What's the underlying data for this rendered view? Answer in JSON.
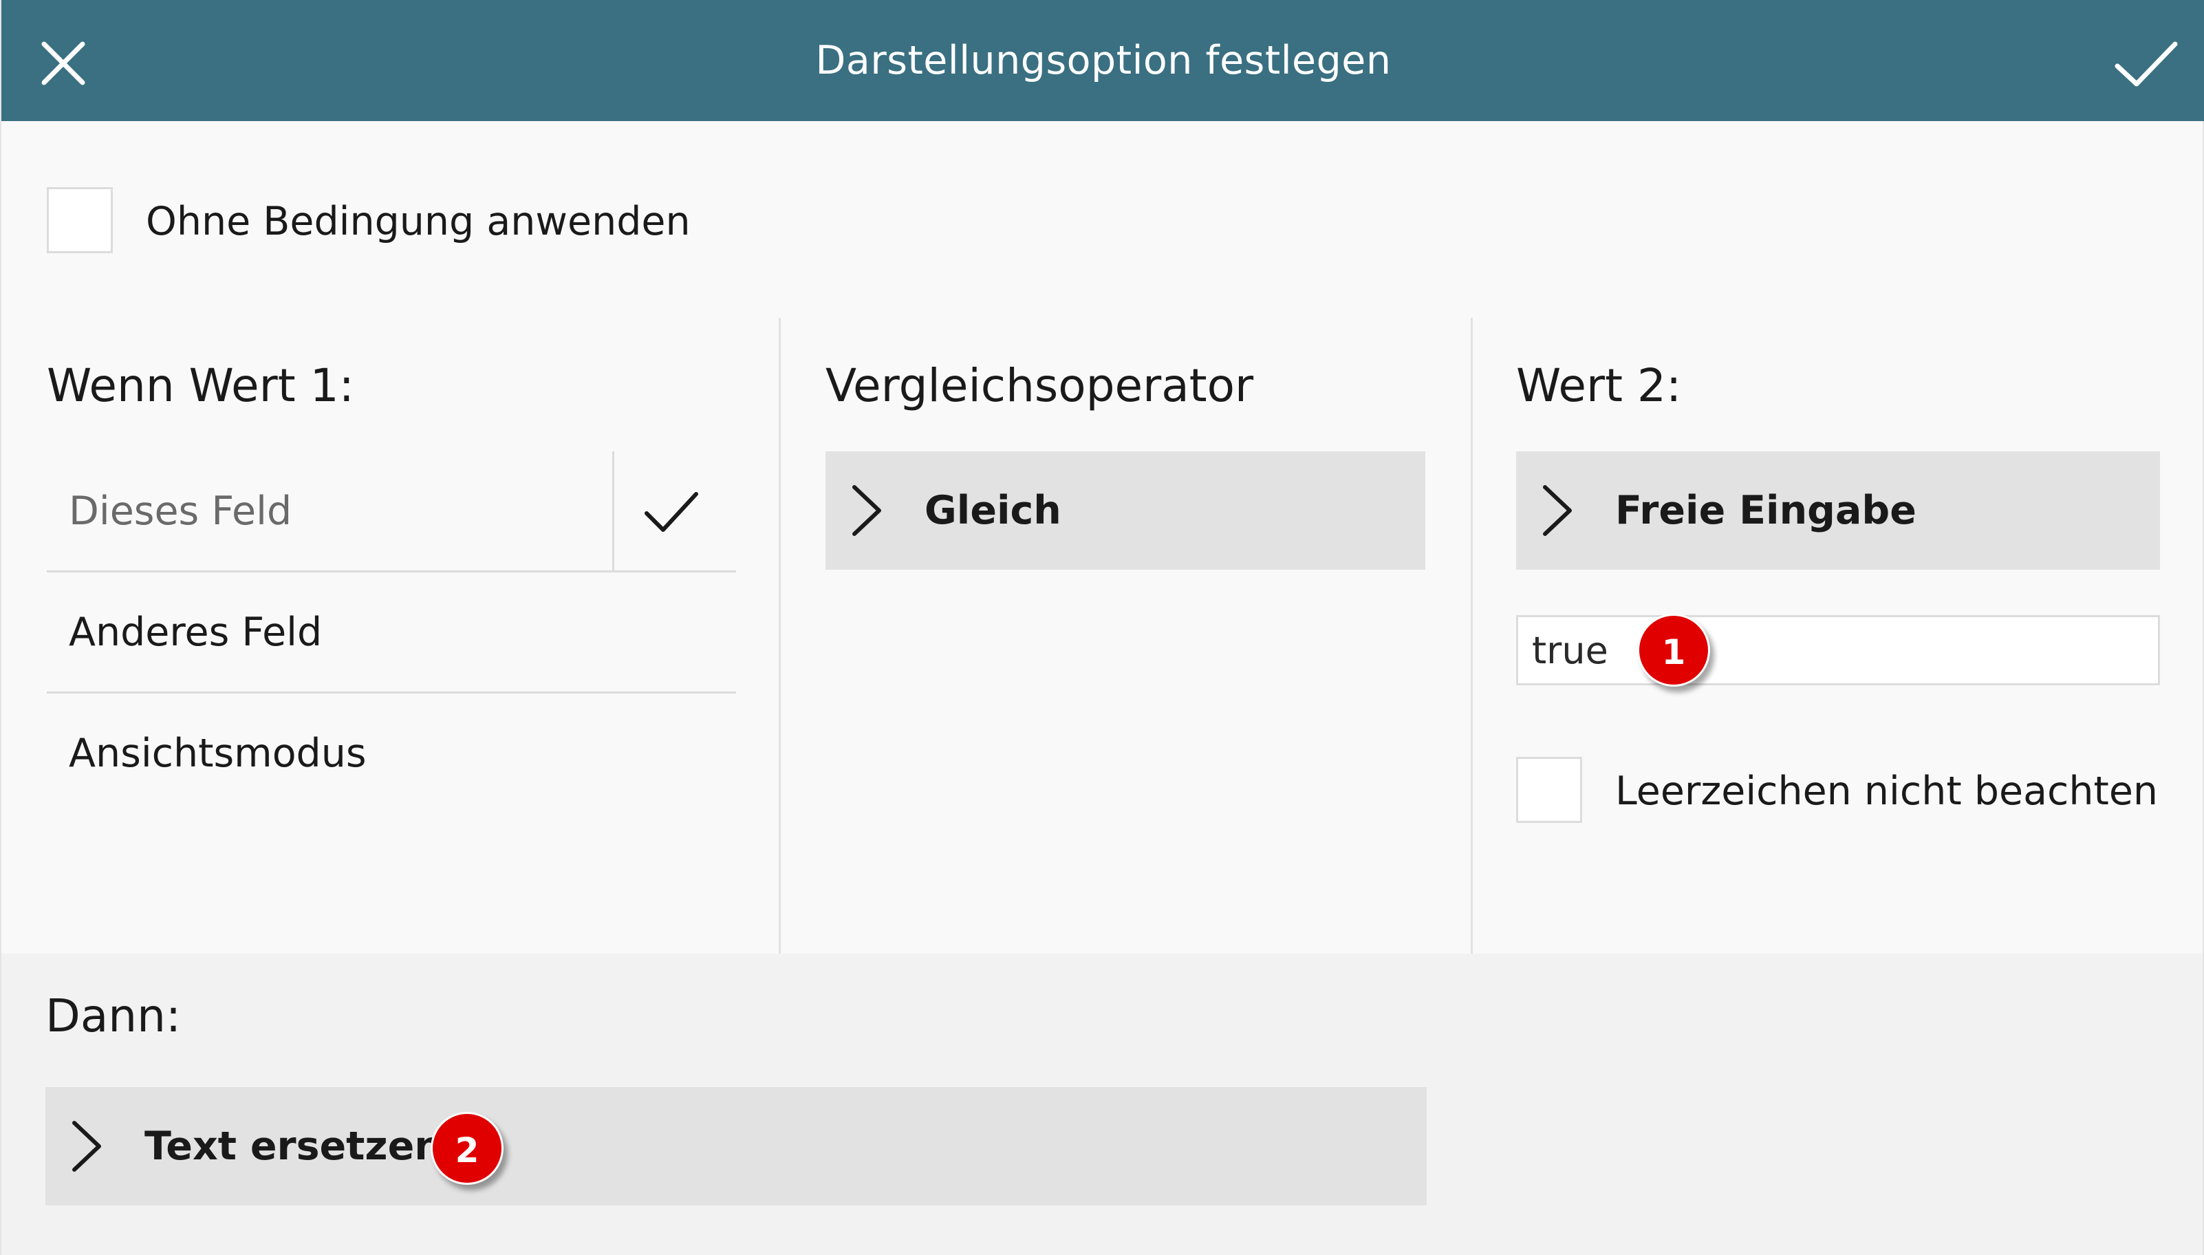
{
  "header": {
    "title": "Darstellungsoption festlegen",
    "close_icon": "close-icon",
    "confirm_icon": "check-icon",
    "background": "#3a7081"
  },
  "unconditional": {
    "label": "Ohne Bedingung anwenden",
    "checked": false
  },
  "value1": {
    "heading": "Wenn Wert 1:",
    "options": [
      {
        "label": "Dieses Feld",
        "selected": true
      },
      {
        "label": "Anderes Feld",
        "selected": false
      },
      {
        "label": "Ansichtsmodus",
        "selected": false
      }
    ]
  },
  "operator": {
    "heading": "Vergleichsoperator",
    "selected": "Gleich"
  },
  "value2": {
    "heading": "Wert 2:",
    "selected": "Freie Eingabe",
    "input_value": "true",
    "ignore_whitespace_label": "Leerzeichen nicht beachten",
    "ignore_whitespace_checked": false
  },
  "then": {
    "heading": "Dann:",
    "selected": "Text ersetzen"
  },
  "badges": {
    "one": "1",
    "two": "2",
    "color": "#e00000"
  }
}
